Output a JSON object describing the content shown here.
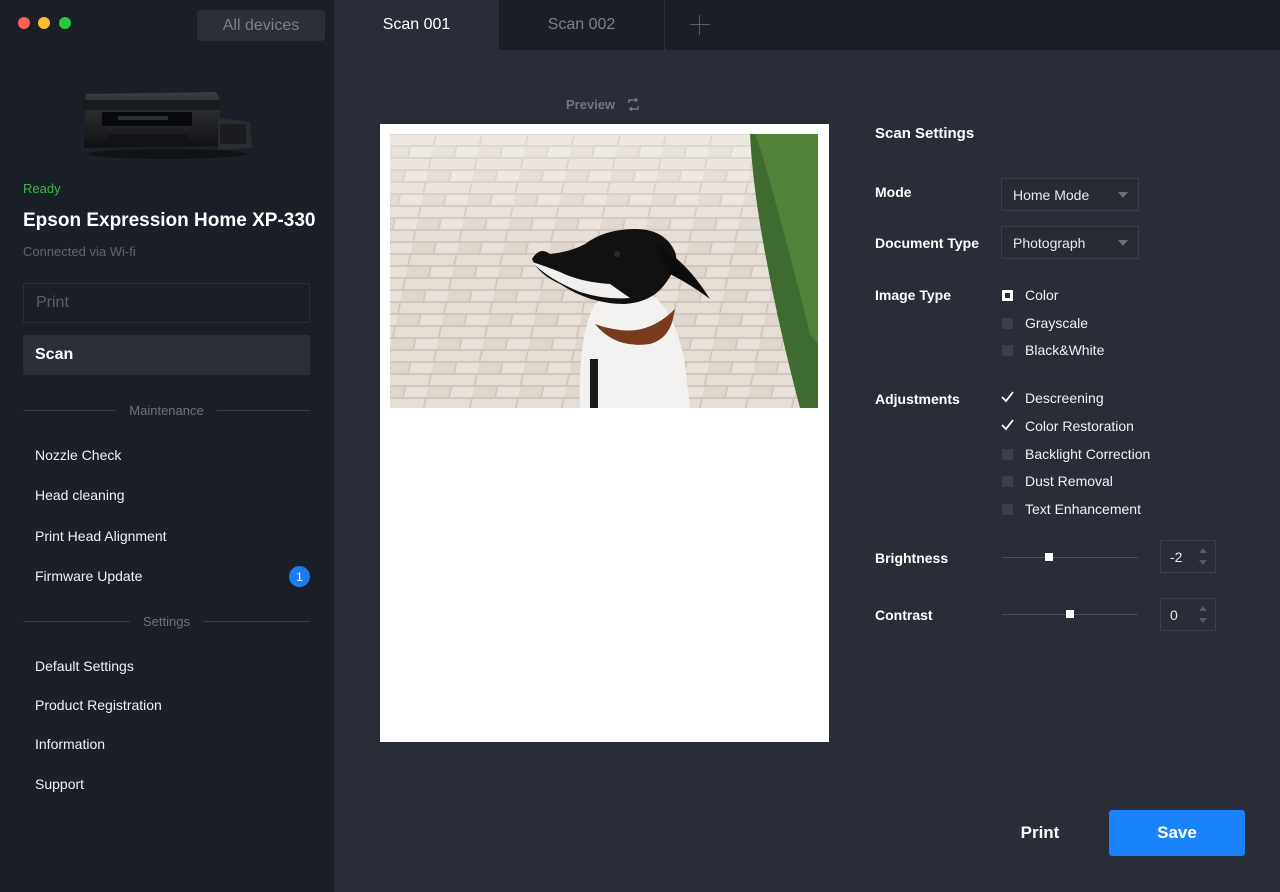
{
  "window": {
    "all_devices": "All devices",
    "tabs": [
      {
        "label": "Scan 001"
      },
      {
        "label": "Scan 002"
      }
    ]
  },
  "sidebar": {
    "status": "Ready",
    "device_name": "Epson Expression Home XP-330",
    "connection": "Connected via Wi-fi",
    "print_label": "Print",
    "scan_label": "Scan",
    "maintenance_heading": "Maintenance",
    "maintenance_items": [
      {
        "label": "Nozzle Check"
      },
      {
        "label": "Head cleaning"
      },
      {
        "label": "Print Head Alignment"
      },
      {
        "label": "Firmware Update",
        "badge": "1"
      }
    ],
    "settings_heading": "Settings",
    "settings_items": [
      {
        "label": "Default Settings"
      },
      {
        "label": "Product Registration"
      },
      {
        "label": "Information"
      },
      {
        "label": "Support"
      }
    ]
  },
  "preview": {
    "label": "Preview"
  },
  "scan_settings": {
    "title": "Scan Settings",
    "mode": {
      "label": "Mode",
      "value": "Home Mode"
    },
    "document_type": {
      "label": "Document Type",
      "value": "Photograph"
    },
    "image_type": {
      "label": "Image Type",
      "options": [
        {
          "label": "Color",
          "selected": true
        },
        {
          "label": "Grayscale",
          "selected": false
        },
        {
          "label": "Black&White",
          "selected": false
        }
      ]
    },
    "adjustments": {
      "label": "Adjustments",
      "options": [
        {
          "label": "Descreening",
          "checked": true
        },
        {
          "label": "Color Restoration",
          "checked": true
        },
        {
          "label": "Backlight Correction",
          "checked": false
        },
        {
          "label": "Dust Removal",
          "checked": false
        },
        {
          "label": "Text Enhancement",
          "checked": false
        }
      ]
    },
    "brightness": {
      "label": "Brightness",
      "value": "-2"
    },
    "contrast": {
      "label": "Contrast",
      "value": "0"
    }
  },
  "actions": {
    "print_label": "Print",
    "save_label": "Save",
    "accent": "#1a82fb"
  }
}
